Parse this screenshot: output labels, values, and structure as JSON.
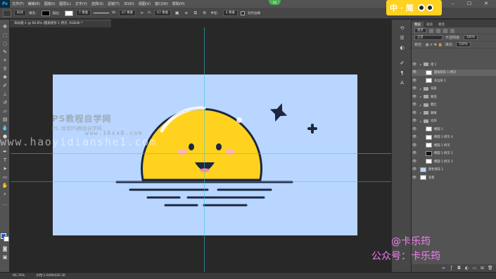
{
  "menubar": {
    "logo": "Ps",
    "items": [
      "文件(F)",
      "编辑(E)",
      "图像(I)",
      "图层(L)",
      "文字(Y)",
      "选择(S)",
      "滤镜(T)",
      "3D(D)",
      "视图(V)",
      "窗口(W)",
      "帮助(H)"
    ],
    "notification": "64"
  },
  "options_bar": {
    "mode": "形状",
    "fill_label": "填充：",
    "stroke_label": "描边：",
    "stroke_size": "7 像素",
    "w_label": "W:",
    "w_value": "67 像素",
    "h_label": "H:",
    "h_value": "67 像素",
    "radius_label": "半径：",
    "radius_value": "4 像素",
    "align_edges": "对齐边缘"
  },
  "brand": {
    "text": "中 · 简"
  },
  "document": {
    "tab": "未标题-1 @ 66.8% (圆角矩形 1 拷贝, RGB/8) *",
    "zoom": "66.76%",
    "docsize": "文档:2.64M/426.3K"
  },
  "panel": {
    "tabs": [
      "图层",
      "通道",
      "路径"
    ],
    "kind_filter": "类型",
    "blend_mode": "正常",
    "opacity_label": "不透明度:",
    "opacity_value": "100%",
    "lock_label": "锁定:",
    "fill_label": "填充:",
    "fill_value": "100%",
    "layers": [
      {
        "name": "组 1",
        "type": "group",
        "indent": 0
      },
      {
        "name": "圆角矩形 1 拷贝",
        "type": "layer",
        "indent": 1,
        "selected": true
      },
      {
        "name": "多边形 1",
        "type": "layer",
        "indent": 1
      },
      {
        "name": "海浪",
        "type": "group",
        "indent": 0
      },
      {
        "name": "眼泪",
        "type": "group",
        "indent": 0
      },
      {
        "name": "腮红",
        "type": "group",
        "indent": 0
      },
      {
        "name": "眼睛",
        "type": "group",
        "indent": 0
      },
      {
        "name": "太阳",
        "type": "group",
        "indent": 0
      },
      {
        "name": "椭圆 1",
        "type": "layer",
        "indent": 1
      },
      {
        "name": "椭圆 1 拷贝 4",
        "type": "layer",
        "indent": 1
      },
      {
        "name": "椭圆 1 拷贝",
        "type": "layer",
        "indent": 1
      },
      {
        "name": "椭圆 1 拷贝 2",
        "type": "layer",
        "indent": 1,
        "dark": true
      },
      {
        "name": "椭圆 1 拷贝 3",
        "type": "layer",
        "indent": 1
      },
      {
        "name": "颜色填充 1",
        "type": "fill",
        "indent": 0
      },
      {
        "name": "背景",
        "type": "layer",
        "indent": 0
      }
    ]
  },
  "watermarks": {
    "ps_title": "PS教程自学网",
    "ps_sub": "PS, 就到PS教程自学网",
    "site_small": "www.16xx8.com",
    "url": "www.haoyidianshe1.com",
    "author": "@卡乐筠",
    "wechat": "公众号：卡乐筠"
  },
  "colors": {
    "canvas_bg": "#b8d6ff",
    "sun_fill": "#ffd21f",
    "sun_outline": "#1d2740",
    "cheek": "#ffb6b6",
    "foreground": "#1d5bd1",
    "background": "#ffffff"
  }
}
